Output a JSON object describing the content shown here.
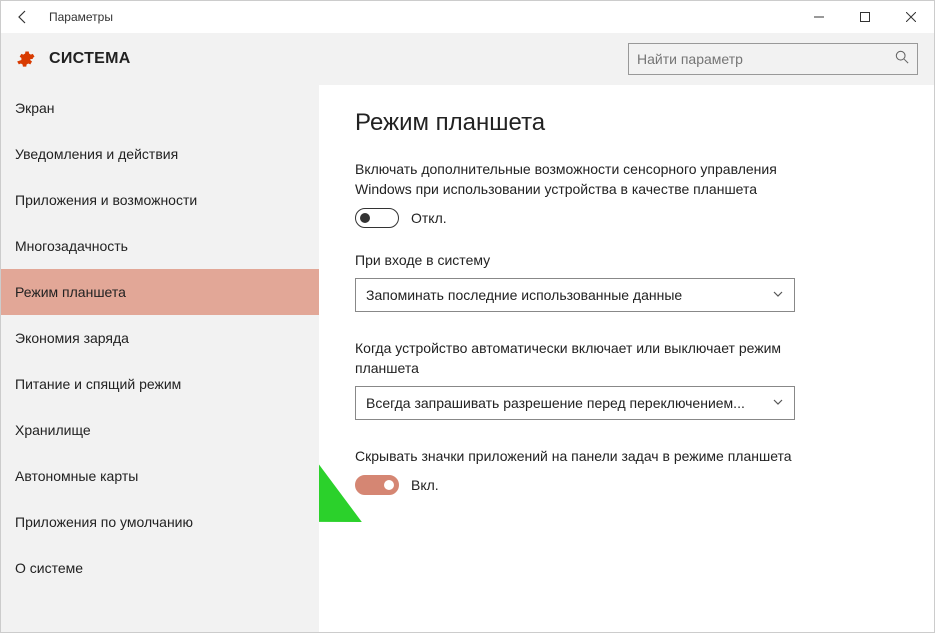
{
  "window": {
    "title": "Параметры"
  },
  "header": {
    "section": "СИСТЕМА",
    "search_placeholder": "Найти параметр"
  },
  "sidebar": {
    "items": [
      {
        "label": "Экран"
      },
      {
        "label": "Уведомления и действия"
      },
      {
        "label": "Приложения и возможности"
      },
      {
        "label": "Многозадачность"
      },
      {
        "label": "Режим планшета"
      },
      {
        "label": "Экономия заряда"
      },
      {
        "label": "Питание и спящий режим"
      },
      {
        "label": "Хранилище"
      },
      {
        "label": "Автономные карты"
      },
      {
        "label": "Приложения по умолчанию"
      },
      {
        "label": "О системе"
      }
    ],
    "selected_index": 4
  },
  "content": {
    "title": "Режим планшета",
    "desc1": "Включать дополнительные возможности сенсорного управления Windows при использовании устройства в качестве планшета",
    "toggle1_state": "off",
    "toggle1_label": "Откл.",
    "label_signin": "При входе в систему",
    "dropdown1": "Запоминать последние использованные данные",
    "label_auto": "Когда устройство автоматически включает или выключает режим планшета",
    "dropdown2": "Всегда запрашивать разрешение перед переключением...",
    "label_hide": "Скрывать значки приложений на панели задач в режиме планшета",
    "toggle2_state": "on",
    "toggle2_label": "Вкл."
  }
}
